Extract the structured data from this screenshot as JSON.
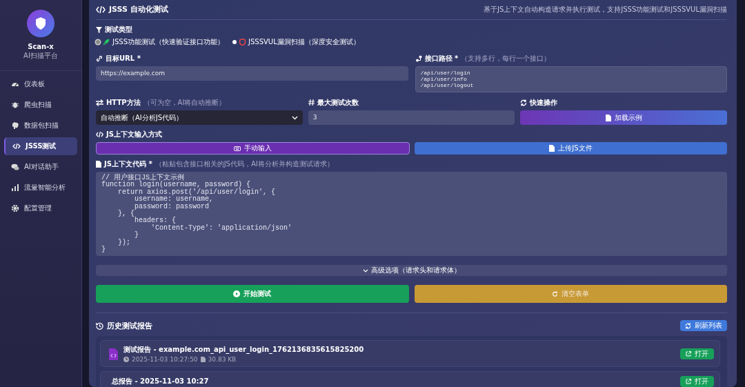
{
  "sidebar": {
    "brand": "Scan-x",
    "subtitle": "AI扫描平台",
    "items": [
      {
        "label": "仪表板",
        "selected": false
      },
      {
        "label": "爬虫扫描",
        "selected": false
      },
      {
        "label": "数据包扫描",
        "selected": false
      },
      {
        "label": "JSSS测试",
        "selected": true
      },
      {
        "label": "AI对话助手",
        "selected": false
      },
      {
        "label": "流量智能分析",
        "selected": false
      },
      {
        "label": "配置管理",
        "selected": false
      }
    ]
  },
  "header": {
    "title": "JSSS 自动化测试",
    "description": "基于JS上下文自动构造请求并执行测试，支持JSSS功能测试和JSSSVUL漏洞扫描"
  },
  "test_type": {
    "label": "测试类型",
    "options": [
      {
        "label": "JSSS功能测试（快速验证接口功能）",
        "selected": true
      },
      {
        "label": "JSSSVUL漏洞扫描（深度安全测试）",
        "selected": false
      }
    ]
  },
  "target_url": {
    "label": "目标URL *",
    "value": "https://example.com"
  },
  "api_paths": {
    "label": "接口路径 *",
    "hint": "（支持多行，每行一个接口）",
    "value": "/api/user/login\n/api/user/info\n/api/user/logout"
  },
  "http_method": {
    "label": "HTTP方法",
    "hint": "（可为空，AI将自动推断）",
    "value": "自动推断（AI分析JS代码）"
  },
  "max_tests": {
    "label": "最大测试次数",
    "value": "3"
  },
  "quick_actions": {
    "label": "快速操作",
    "button": "加载示例"
  },
  "input_mode": {
    "label": "JS上下文输入方式",
    "options": [
      {
        "label": "手动输入",
        "selected": true
      },
      {
        "label": "上传JS文件",
        "selected": false
      }
    ]
  },
  "js_code": {
    "label": "JS上下文代码 *",
    "hint": "（粘贴包含接口相关的JS代码，AI将分析并构造测试请求）",
    "value": "// 用户接口JS上下文示例\nfunction login(username, password) {\n    return axios.post('/api/user/login', {\n        username: username,\n        password: password\n    }, {\n        headers: {\n            'Content-Type': 'application/json'\n        }\n    });\n}"
  },
  "advanced": {
    "label": "高级选项（请求头和请求体）",
    "expanded": false
  },
  "actions": {
    "start": "开始测试",
    "clear": "清空表单"
  },
  "history": {
    "title": "历史测试报告",
    "refresh": "刷新列表",
    "reports": [
      {
        "title": "测试报告 - example.com_api_user_login_1762136835615825200",
        "time": "2025-11-03 10:27:50",
        "size": "30.83 KB",
        "open": "打开",
        "kind": "file"
      },
      {
        "title": "总报告 - 2025-11-03 10:27",
        "open": "打开",
        "kind": "plain"
      }
    ]
  }
}
